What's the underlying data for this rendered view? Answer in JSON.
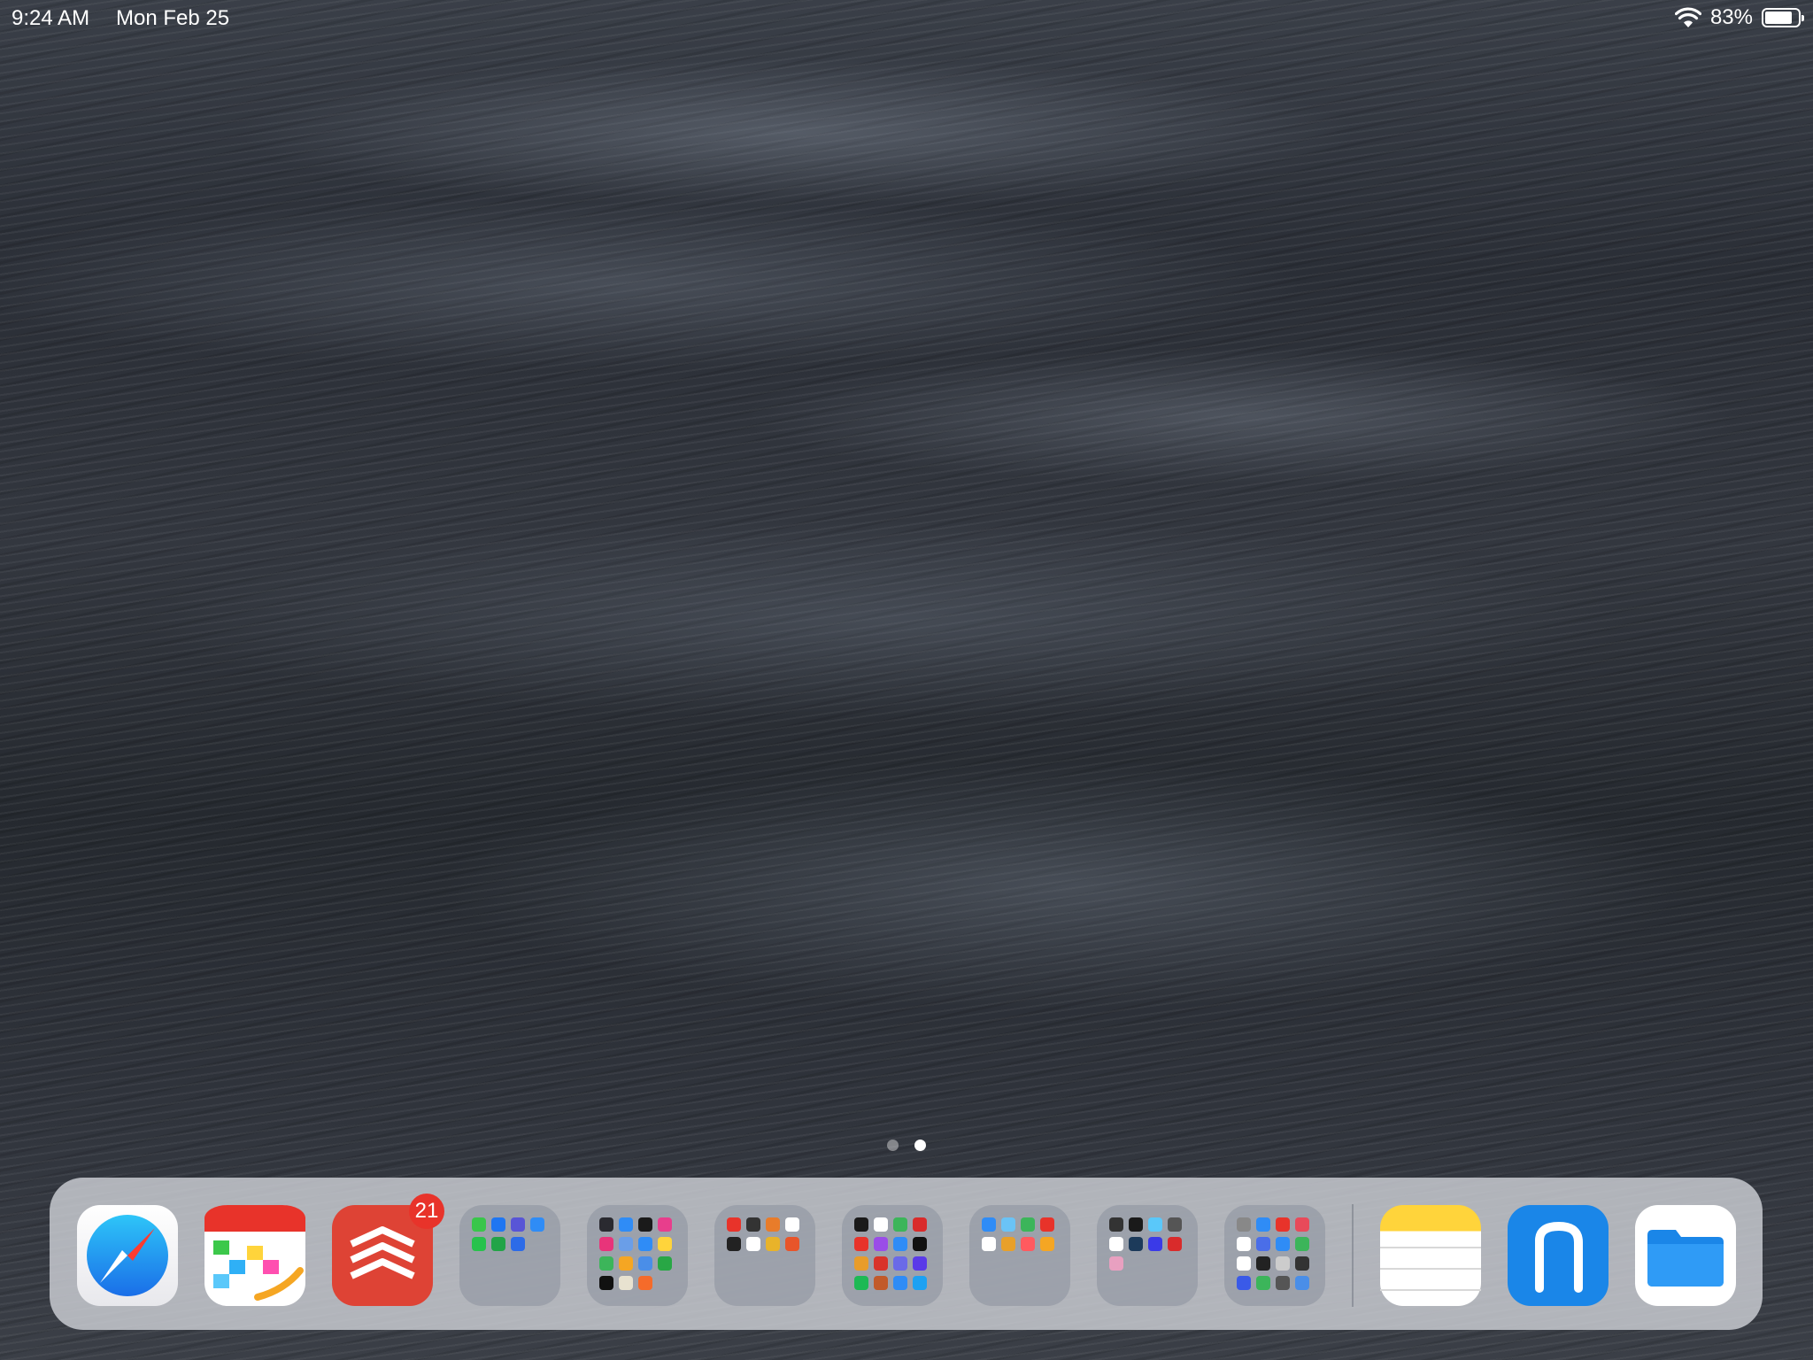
{
  "status_bar": {
    "time": "9:24 AM",
    "date": "Mon Feb 25",
    "battery_percent": "83%",
    "battery_level": 0.83,
    "wifi_icon": "wifi-icon",
    "battery_icon": "battery-icon"
  },
  "home": {
    "wallpaper": "ocean-waves",
    "page_count": 2,
    "current_page": 2
  },
  "dock": {
    "apps": [
      {
        "name": "safari",
        "icon": "safari-compass-icon",
        "color": "#1a8cf0"
      },
      {
        "name": "fantastical",
        "icon": "fantastical-calendar-icon",
        "color": "#e8332a"
      },
      {
        "name": "todoist",
        "icon": "todoist-icon",
        "color": "#de4335",
        "badge": "21"
      },
      {
        "name": "folder-1",
        "icon": "folder-icon",
        "minis": [
          "#39c64a",
          "#1f76f2",
          "#5855d6",
          "#2f8cf6",
          "#27c24c",
          "#22a447",
          "#2c6be8"
        ]
      },
      {
        "name": "folder-2",
        "icon": "folder-icon",
        "minis": [
          "#2a2a30",
          "#2f8cf6",
          "#1a1a1a",
          "#e83e8c",
          "#e8347a",
          "#6a9ee8",
          "#2f8cf6",
          "#ffd43b",
          "#3cb55a",
          "#f5a623",
          "#4a8ee8",
          "#28a745",
          "#111",
          "#e8e2d0",
          "#f56b2a"
        ]
      },
      {
        "name": "folder-3",
        "icon": "folder-icon",
        "minis": [
          "#e8332a",
          "#333",
          "#e87c2a",
          "#fff",
          "#222",
          "#fff",
          "#e8b32a",
          "#e8552a"
        ]
      },
      {
        "name": "folder-4",
        "icon": "folder-icon",
        "minis": [
          "#1a1a1a",
          "#fff",
          "#3cb55a",
          "#d92b2b",
          "#e8332a",
          "#9a4de8",
          "#2f8cf6",
          "#111",
          "#e89c2a",
          "#d9332a",
          "#6a6ae8",
          "#5a3ae8",
          "#1db954",
          "#c25a2a",
          "#2f8cf6",
          "#1da1f2"
        ]
      },
      {
        "name": "folder-5",
        "icon": "folder-icon",
        "minis": [
          "#2f8cf6",
          "#6ac3f6",
          "#3cb55a",
          "#e8332a",
          "#fff",
          "#e8a02a",
          "#ff5a5f",
          "#f5a623"
        ]
      },
      {
        "name": "folder-6",
        "icon": "folder-icon",
        "minis": [
          "#333",
          "#1a1a1a",
          "#5ac8fa",
          "#555",
          "#fff",
          "#1c3a5a",
          "#3a3ae8",
          "#d92b2b",
          "#e8a0c0"
        ]
      },
      {
        "name": "folder-7",
        "icon": "folder-icon",
        "minis": [
          "#888",
          "#2f8cf6",
          "#e8332a",
          "#e84a5a",
          "#fff",
          "#4a6ee8",
          "#2f8cf6",
          "#3cb55a",
          "#fff",
          "#222",
          "#ccc",
          "#333",
          "#3a5ae8",
          "#3cb55a",
          "#555",
          "#4a8ee8"
        ]
      },
      {
        "name": "notes",
        "icon": "notes-icon",
        "color": "#ffd43b"
      },
      {
        "name": "nebo",
        "icon": "nebo-icon",
        "color": "#1a86e8"
      },
      {
        "name": "files",
        "icon": "files-folder-icon",
        "color": "#1a86e8"
      }
    ]
  }
}
